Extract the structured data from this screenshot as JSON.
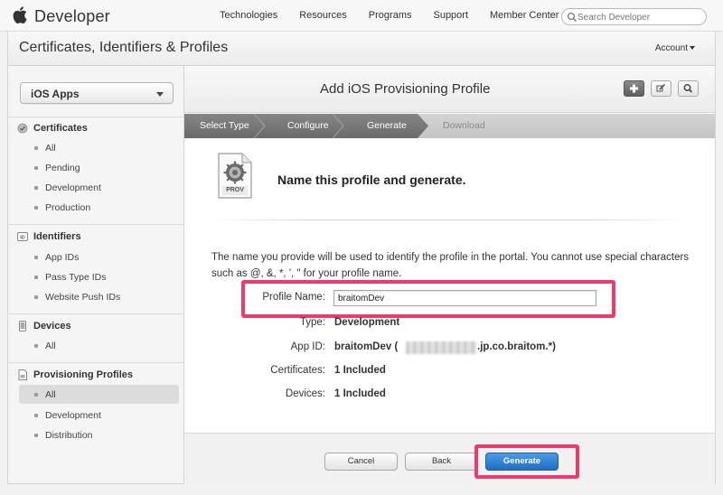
{
  "topnav": {
    "brand": "Developer",
    "links": [
      "Technologies",
      "Resources",
      "Programs",
      "Support",
      "Member Center"
    ],
    "search_placeholder": "Search Developer"
  },
  "subheader": {
    "title": "Certificates, Identifiers & Profiles",
    "account": "Account"
  },
  "sidebar": {
    "platform_select": "iOS Apps",
    "sections": [
      {
        "title": "Certificates",
        "icon": "certificate-icon",
        "items": [
          "All",
          "Pending",
          "Development",
          "Production"
        ]
      },
      {
        "title": "Identifiers",
        "icon": "id-icon",
        "items": [
          "App IDs",
          "Pass Type IDs",
          "Website Push IDs"
        ]
      },
      {
        "title": "Devices",
        "icon": "device-icon",
        "items": [
          "All"
        ]
      },
      {
        "title": "Provisioning Profiles",
        "icon": "profile-icon",
        "items": [
          "All",
          "Development",
          "Distribution"
        ]
      }
    ],
    "active_item": "Provisioning Profiles / All"
  },
  "main": {
    "title": "Add iOS Provisioning Profile",
    "toolbar_icons": [
      "plus-icon",
      "edit-icon",
      "search-icon"
    ],
    "steps": [
      "Select Type",
      "Configure",
      "Generate",
      "Download"
    ],
    "current_step": "Generate",
    "prov_icon_label": "PROV",
    "heading": "Name this profile and generate.",
    "description": "The name you provide will be used to identify the profile in the portal. You cannot use special characters such as @, &, *, ', \" for your profile name.",
    "form": {
      "profile_name_label": "Profile Name:",
      "profile_name_value": "braitomDev",
      "type_label": "Type:",
      "type_value": "Development",
      "app_id_label": "App ID:",
      "app_id_prefix": "braitomDev (",
      "app_id_suffix": ".jp.co.braitom.*)",
      "certificates_label": "Certificates:",
      "certificates_value": "1 Included",
      "devices_label": "Devices:",
      "devices_value": "1 Included"
    },
    "buttons": {
      "cancel": "Cancel",
      "back": "Back",
      "generate": "Generate"
    },
    "highlight_color": "#ee3b6e",
    "accent_color": "#1f6ec5"
  }
}
